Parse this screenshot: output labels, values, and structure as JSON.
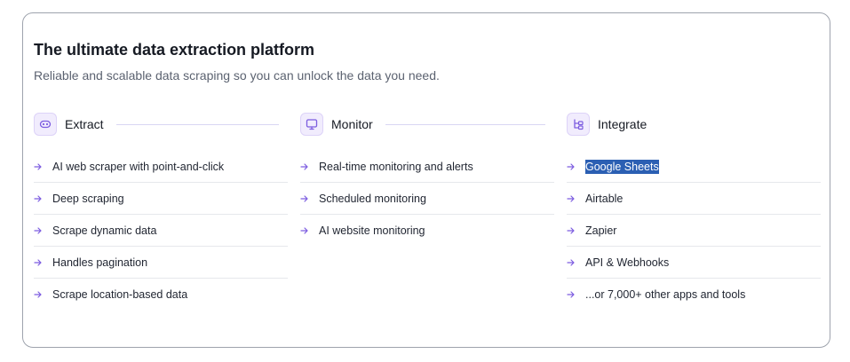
{
  "title": "The ultimate data extraction platform",
  "subtitle": "Reliable and scalable data scraping so you can unlock the data you need.",
  "accent_color": "#7c5ce0",
  "columns": [
    {
      "label": "Extract",
      "icon": "robot-icon",
      "items": [
        "AI web scraper with point-and-click",
        "Deep scraping",
        "Scrape dynamic data",
        "Handles pagination",
        "Scrape location-based data"
      ]
    },
    {
      "label": "Monitor",
      "icon": "monitor-icon",
      "items": [
        "Real-time monitoring and alerts",
        "Scheduled monitoring",
        "AI website monitoring"
      ]
    },
    {
      "label": "Integrate",
      "icon": "integration-icon",
      "items": [
        "Google Sheets",
        "Airtable",
        "Zapier",
        "API & Webhooks",
        "...or 7,000+ other apps and tools"
      ],
      "selected_item": "Google Sheets"
    }
  ]
}
